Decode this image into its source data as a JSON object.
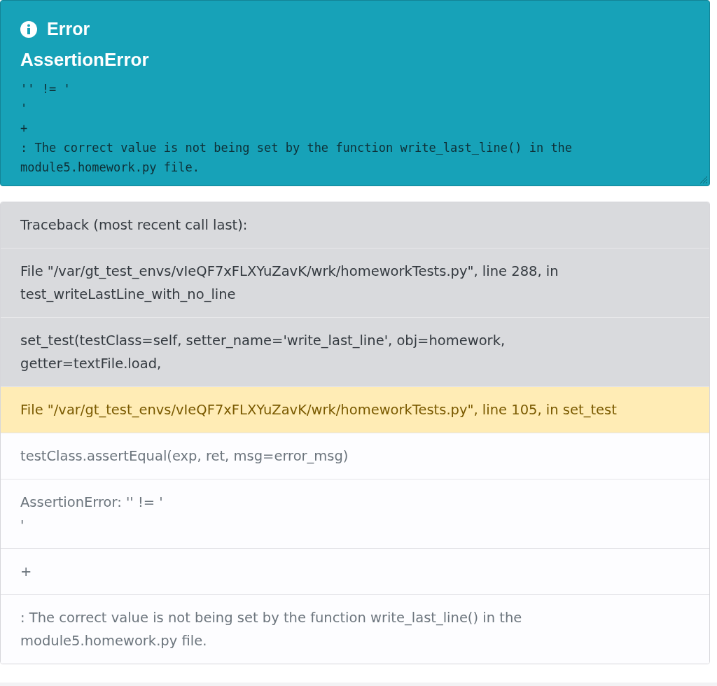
{
  "alert": {
    "title": "Error",
    "heading": "AssertionError",
    "message": "'' != '\n'\n+\n: The correct value is not being set by the function write_last_line() in the\nmodule5.homework.py file."
  },
  "traceback": [
    {
      "kind": "library",
      "text": "Traceback (most recent call last):"
    },
    {
      "kind": "library",
      "text": "File \"/var/gt_test_envs/vIeQF7xFLXYuZavK/wrk/homeworkTests.py\", line 288, in test_writeLastLine_with_no_line"
    },
    {
      "kind": "library",
      "text": "set_test(testClass=self, setter_name='write_last_line', obj=homework, getter=textFile.load,"
    },
    {
      "kind": "highlight",
      "text": "File \"/var/gt_test_envs/vIeQF7xFLXYuZavK/wrk/homeworkTests.py\", line 105, in set_test"
    },
    {
      "kind": "user",
      "text": "testClass.assertEqual(exp, ret, msg=error_msg)"
    },
    {
      "kind": "user",
      "text": "AssertionError: '' != '\n'\n"
    },
    {
      "kind": "user",
      "text": "+"
    },
    {
      "kind": "user",
      "text": ": The correct value is not being set by the function write_last_line() in the module5.homework.py file."
    }
  ]
}
